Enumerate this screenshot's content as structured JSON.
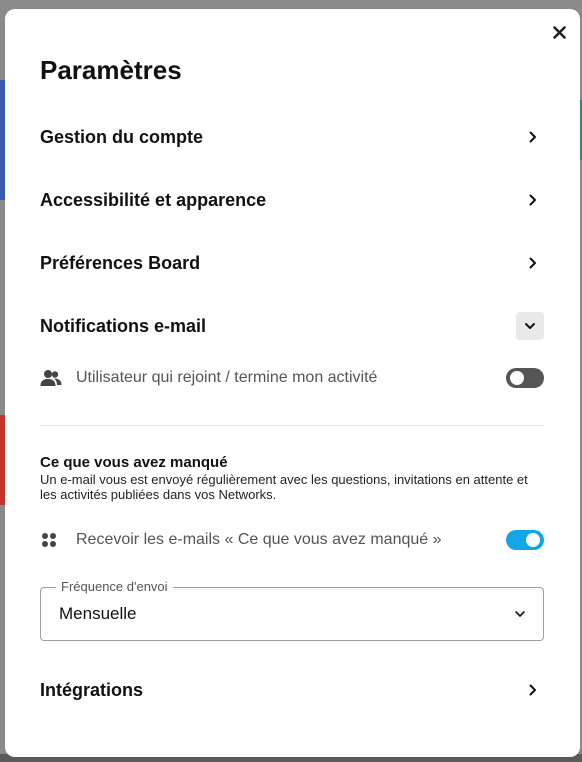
{
  "modal": {
    "title": "Paramètres",
    "close_icon": "close-icon"
  },
  "sections": {
    "account": {
      "label": "Gestion du compte",
      "icon": "chevron-right-icon"
    },
    "accessibility": {
      "label": "Accessibilité et apparence",
      "icon": "chevron-right-icon"
    },
    "board_prefs": {
      "label": "Préférences Board",
      "icon": "chevron-right-icon"
    },
    "email_notifications": {
      "label": "Notifications e-mail",
      "icon": "chevron-down-icon",
      "expanded": true
    },
    "integrations": {
      "label": "Intégrations",
      "icon": "chevron-right-icon"
    }
  },
  "email_notifications": {
    "user_join": {
      "label": "Utilisateur qui rejoint / termine mon activité",
      "icon": "users-icon",
      "enabled": false
    },
    "missed": {
      "title": "Ce que vous avez manqué",
      "description": "Un e-mail vous est envoyé régulièrement avec les questions, invitations en attente et les activités publiées dans vos Networks.",
      "receive": {
        "label": "Recevoir les e-mails « Ce que vous avez manqué »",
        "icon": "apps-icon",
        "enabled": true
      },
      "frequency": {
        "legend": "Fréquence d'envoi",
        "value": "Mensuelle",
        "icon": "chevron-down-icon"
      }
    }
  },
  "colors": {
    "toggle_on": "#12a6e6",
    "toggle_off": "#555555"
  }
}
